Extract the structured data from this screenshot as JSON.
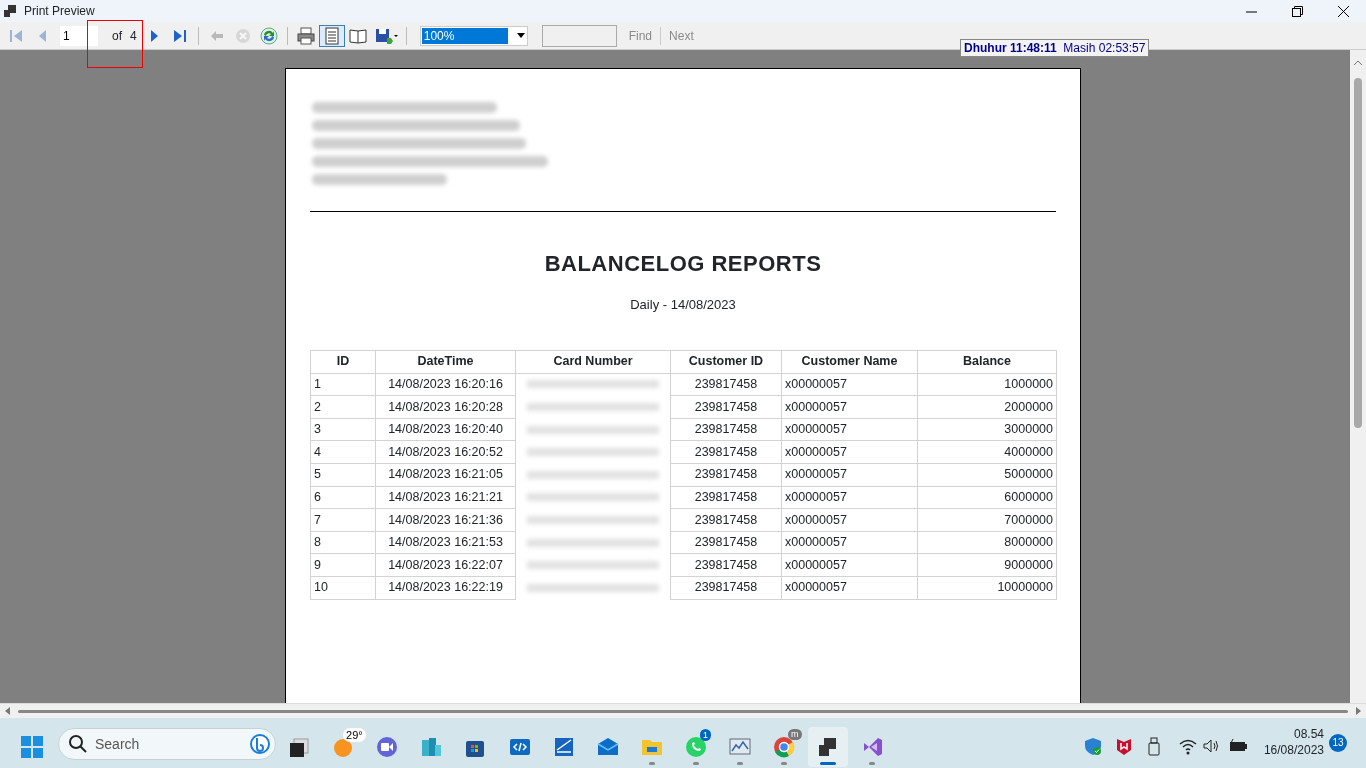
{
  "window": {
    "title": "Print Preview"
  },
  "toolbar": {
    "buttons": [
      {
        "kind": "first",
        "disabled": true,
        "selected": false
      },
      {
        "kind": "prev",
        "disabled": true,
        "selected": false
      },
      {
        "kind": "page_field",
        "value": "1"
      },
      {
        "kind": "of_label",
        "text": "of"
      },
      {
        "kind": "page_count",
        "text": "4"
      },
      {
        "kind": "next",
        "disabled": false,
        "selected": false
      },
      {
        "kind": "last",
        "disabled": false,
        "selected": false
      },
      {
        "kind": "sep"
      },
      {
        "kind": "back",
        "disabled": true,
        "selected": false
      },
      {
        "kind": "stop",
        "disabled": true,
        "selected": false
      },
      {
        "kind": "refresh",
        "disabled": false,
        "selected": false
      },
      {
        "kind": "sep"
      },
      {
        "kind": "print",
        "disabled": false,
        "selected": false
      },
      {
        "kind": "one_page",
        "disabled": false,
        "selected": true
      },
      {
        "kind": "two_page",
        "disabled": false,
        "selected": false
      },
      {
        "kind": "save",
        "disabled": false,
        "selected": false
      },
      {
        "kind": "sep"
      },
      {
        "kind": "zoom",
        "value": "100%"
      },
      {
        "kind": "find_field"
      },
      {
        "kind": "find",
        "text": "Find",
        "disabled": true
      },
      {
        "kind": "next_link",
        "text": "Next",
        "disabled": true
      }
    ]
  },
  "prayer_widget": {
    "prayer": "Dhuhur 11:48:11",
    "remaining": "Masih 02:53:57"
  },
  "report": {
    "title": "BALANCELOG REPORTS",
    "subtitle": "Daily - 14/08/2023",
    "columns": [
      "ID",
      "DateTime",
      "Card Number",
      "Customer ID",
      "Customer Name",
      "Balance"
    ],
    "rows": [
      {
        "id": "1",
        "datetime": "14/08/2023 16:20:16",
        "customer_id": "239817458",
        "customer_name": "x00000057",
        "balance": "1000000"
      },
      {
        "id": "2",
        "datetime": "14/08/2023 16:20:28",
        "customer_id": "239817458",
        "customer_name": "x00000057",
        "balance": "2000000"
      },
      {
        "id": "3",
        "datetime": "14/08/2023 16:20:40",
        "customer_id": "239817458",
        "customer_name": "x00000057",
        "balance": "3000000"
      },
      {
        "id": "4",
        "datetime": "14/08/2023 16:20:52",
        "customer_id": "239817458",
        "customer_name": "x00000057",
        "balance": "4000000"
      },
      {
        "id": "5",
        "datetime": "14/08/2023 16:21:05",
        "customer_id": "239817458",
        "customer_name": "x00000057",
        "balance": "5000000"
      },
      {
        "id": "6",
        "datetime": "14/08/2023 16:21:21",
        "customer_id": "239817458",
        "customer_name": "x00000057",
        "balance": "6000000"
      },
      {
        "id": "7",
        "datetime": "14/08/2023 16:21:36",
        "customer_id": "239817458",
        "customer_name": "x00000057",
        "balance": "7000000"
      },
      {
        "id": "8",
        "datetime": "14/08/2023 16:21:53",
        "customer_id": "239817458",
        "customer_name": "x00000057",
        "balance": "8000000"
      },
      {
        "id": "9",
        "datetime": "14/08/2023 16:22:07",
        "customer_id": "239817458",
        "customer_name": "x00000057",
        "balance": "9000000"
      },
      {
        "id": "10",
        "datetime": "14/08/2023 16:22:19",
        "customer_id": "239817458",
        "customer_name": "x00000057",
        "balance": "10000000"
      }
    ]
  },
  "taskbar": {
    "search_placeholder": "Search",
    "apps": [
      {
        "kind": "taskview",
        "running": false,
        "active": false
      },
      {
        "kind": "weather",
        "badge": "29°",
        "running": false,
        "active": false
      },
      {
        "kind": "meet",
        "running": false,
        "active": false
      },
      {
        "kind": "buildings",
        "running": false,
        "active": false
      },
      {
        "kind": "store",
        "running": false,
        "active": false
      },
      {
        "kind": "dev",
        "running": false,
        "active": false
      },
      {
        "kind": "scanner",
        "running": false,
        "active": false
      },
      {
        "kind": "mail",
        "running": false,
        "active": false
      },
      {
        "kind": "folder",
        "running": true,
        "active": false
      },
      {
        "kind": "chat",
        "badge": "1",
        "running": true,
        "active": false
      },
      {
        "kind": "monitor",
        "running": true,
        "active": false
      },
      {
        "kind": "browser",
        "badge": "m",
        "running": true,
        "active": false
      },
      {
        "kind": "preview",
        "running": true,
        "active": true
      },
      {
        "kind": "studio",
        "running": true,
        "active": false
      }
    ],
    "time": "08.54",
    "date": "16/08/2023",
    "notifications": "13"
  }
}
